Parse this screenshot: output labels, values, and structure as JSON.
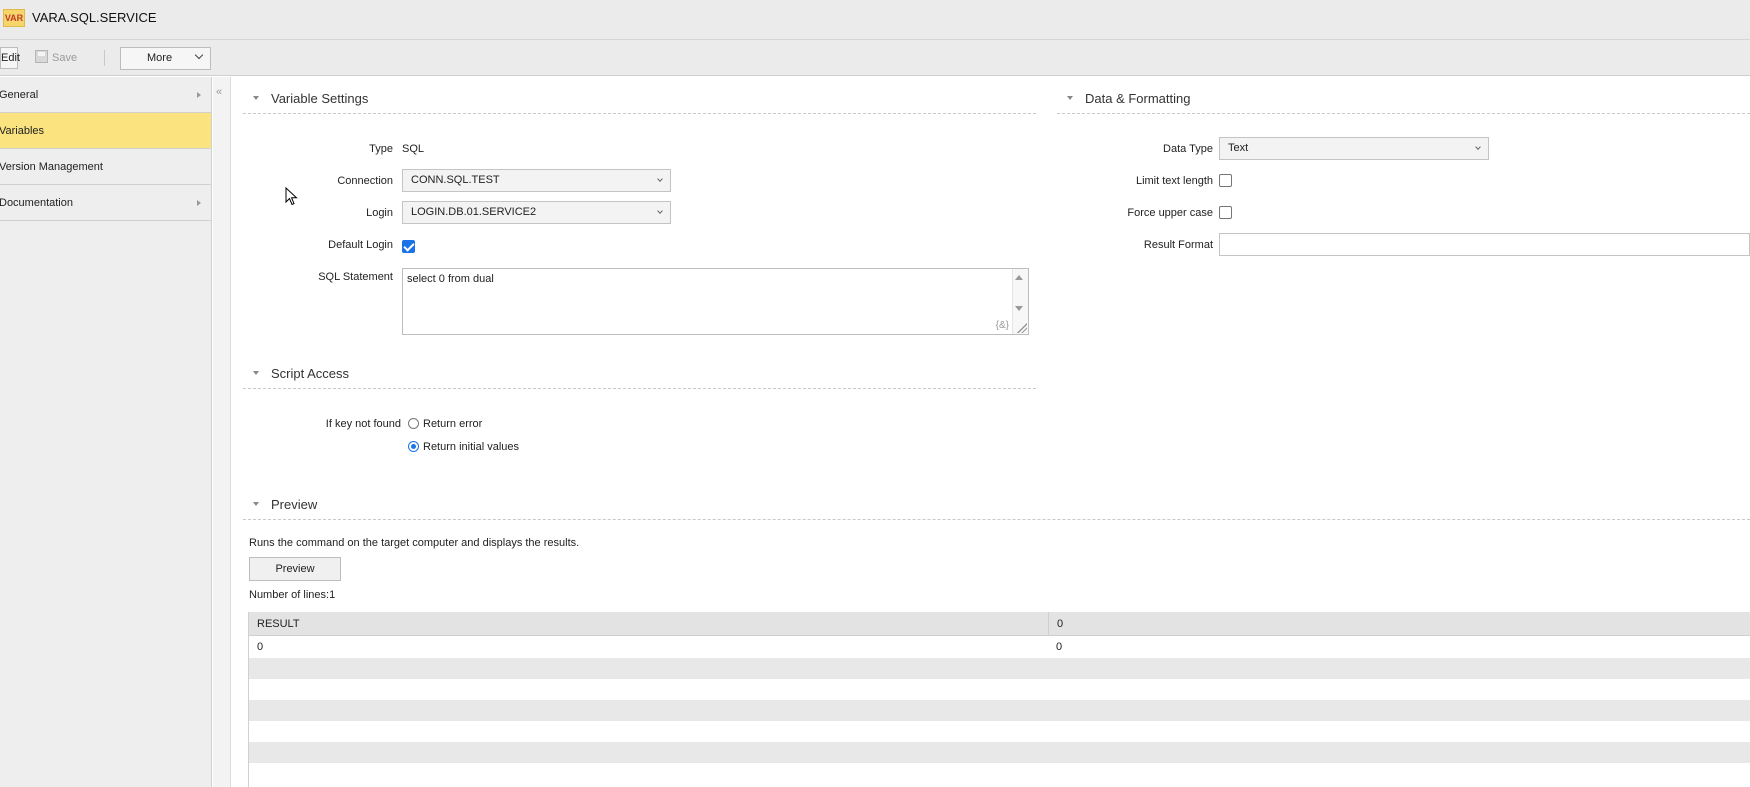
{
  "window": {
    "icon_text": "VAR",
    "title": "VARA.SQL.SERVICE"
  },
  "toolbar": {
    "edit_label": "Edit",
    "save_label": "Save",
    "more_label": "More"
  },
  "sidebar": {
    "collapse_glyph": "«",
    "items": [
      {
        "label": "General",
        "has_arrow": true,
        "active": false
      },
      {
        "label": "Variables",
        "has_arrow": false,
        "active": true
      },
      {
        "label": "Version Management",
        "has_arrow": false,
        "active": false
      },
      {
        "label": "Documentation",
        "has_arrow": true,
        "active": false
      }
    ]
  },
  "variable_settings": {
    "header": "Variable Settings",
    "type_label": "Type",
    "type_value": "SQL",
    "connection_label": "Connection",
    "connection_value": "CONN.SQL.TEST",
    "login_label": "Login",
    "login_value": "LOGIN.DB.01.SERVICE2",
    "default_login_label": "Default Login",
    "default_login_checked": true,
    "sql_label": "SQL Statement",
    "sql_value": "select 0 from dual",
    "sql_var_glyph": "{&}"
  },
  "data_formatting": {
    "header": "Data & Formatting",
    "data_type_label": "Data Type",
    "data_type_value": "Text",
    "limit_text_label": "Limit text length",
    "limit_text_checked": false,
    "force_upper_label": "Force upper case",
    "force_upper_checked": false,
    "result_format_label": "Result Format",
    "result_format_value": ""
  },
  "script_access": {
    "header": "Script Access",
    "if_key_label": "If key not found",
    "options": [
      {
        "label": "Return error",
        "selected": false
      },
      {
        "label": "Return initial values",
        "selected": true
      }
    ]
  },
  "preview": {
    "header": "Preview",
    "description": "Runs the command on the target computer and displays the results.",
    "button_label": "Preview",
    "lines_text": "Number of lines:1",
    "columns": [
      "RESULT",
      "0"
    ],
    "rows": [
      [
        "0",
        "0"
      ]
    ]
  },
  "colors": {
    "active_nav": "#fbe37f",
    "checkbox_accent": "#1a73e8"
  }
}
